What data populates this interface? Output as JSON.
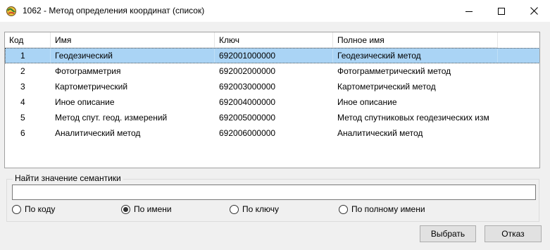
{
  "window": {
    "title": "1062 -  Метод определения координат (список)",
    "icon": "map-app-icon",
    "controls": [
      "minimize-icon",
      "maximize-icon",
      "close-icon"
    ]
  },
  "table": {
    "columns": [
      "Код",
      "Имя",
      "Ключ",
      "Полное имя"
    ],
    "selected_row": 0,
    "rows": [
      {
        "code": "1",
        "name": "Геодезический",
        "key": "692001000000",
        "full": "Геодезический метод"
      },
      {
        "code": "2",
        "name": "Фотограмметрия",
        "key": "692002000000",
        "full": "Фотограмметрический метод"
      },
      {
        "code": "3",
        "name": "Картометрический",
        "key": "692003000000",
        "full": "Картометрический метод"
      },
      {
        "code": "4",
        "name": "Иное описание",
        "key": "692004000000",
        "full": "Иное описание"
      },
      {
        "code": "5",
        "name": "Метод спут. геод. измерений",
        "key": "692005000000",
        "full": "Метод спутниковых геодезических изм"
      },
      {
        "code": "6",
        "name": "Аналитический метод",
        "key": "692006000000",
        "full": "Аналитический метод"
      }
    ]
  },
  "search": {
    "group_label": "Найти значение семантики",
    "value": "",
    "options": [
      "По коду",
      "По имени",
      "По ключу",
      "По полному имени"
    ],
    "selected_option": "По имени"
  },
  "buttons": {
    "select_label": "Выбрать",
    "cancel_label": "Отказ"
  },
  "colors": {
    "selection": "#aad4f5",
    "window_bg": "#f0f0f0"
  }
}
